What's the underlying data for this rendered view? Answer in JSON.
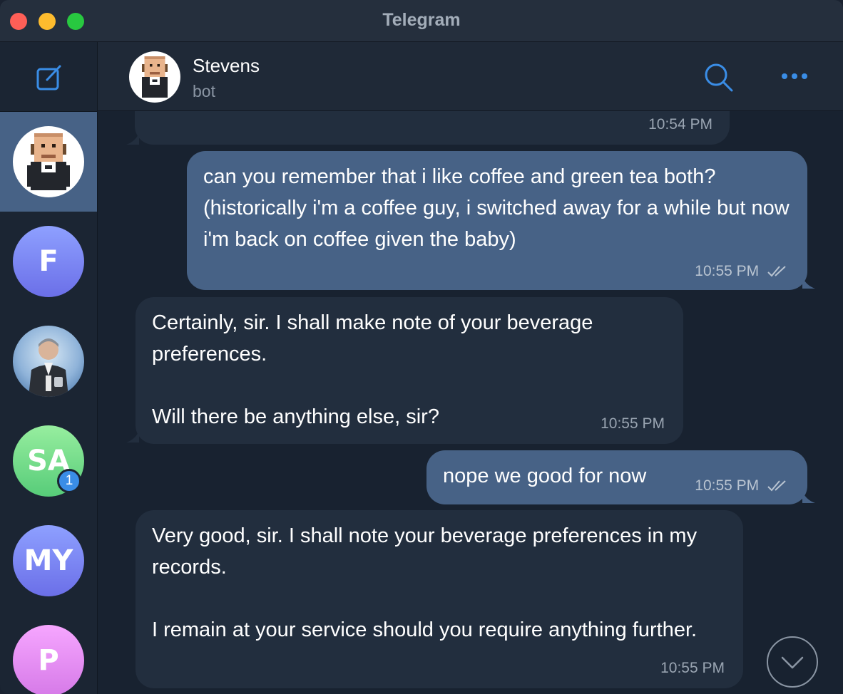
{
  "window": {
    "title": "Telegram"
  },
  "header": {
    "name": "Stevens",
    "status": "bot"
  },
  "sidebar": {
    "chats": [
      {
        "initials": "",
        "active": true,
        "avatar": "pixel-butler-avatar"
      },
      {
        "initials": "F"
      },
      {
        "initials": "",
        "avatar": "butler-photo-avatar"
      },
      {
        "initials": "SA",
        "unread": "1"
      },
      {
        "initials": "MY"
      },
      {
        "initials": "P"
      }
    ]
  },
  "messages": [
    {
      "direction": "in",
      "text": "",
      "time": "10:54 PM"
    },
    {
      "direction": "out",
      "text": "can you remember that i like coffee and green tea both? (historically i'm a coffee guy, i switched away for a while but now i'm back on coffee given the baby)",
      "time": "10:55 PM",
      "read": true
    },
    {
      "direction": "in",
      "text": "Certainly, sir. I shall make note of your beverage preferences.\n\nWill there be anything else, sir?",
      "time": "10:55 PM"
    },
    {
      "direction": "out",
      "text": "nope we good for now",
      "time": "10:55 PM",
      "read": true
    },
    {
      "direction": "in",
      "text": "Very good, sir. I shall note your beverage preferences in my records.\n\nI remain at your service should you require anything further.",
      "time": "10:55 PM"
    }
  ],
  "colors": {
    "accent": "#3a8de6",
    "outgoing_bubble": "#476286",
    "incoming_bubble": "#222e3e"
  }
}
